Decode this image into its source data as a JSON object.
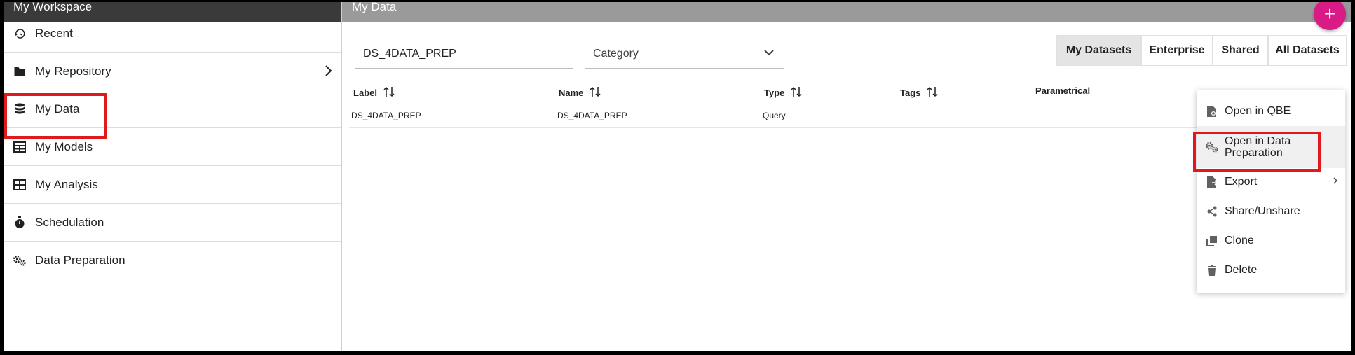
{
  "sidebar": {
    "title": "My Workspace",
    "items": [
      {
        "label": "Recent",
        "icon": "history-icon"
      },
      {
        "label": "My Repository",
        "icon": "folder-icon"
      },
      {
        "label": "My Data",
        "icon": "database-icon"
      },
      {
        "label": "My Models",
        "icon": "table-icon"
      },
      {
        "label": "My Analysis",
        "icon": "grid-icon"
      },
      {
        "label": "Schedulation",
        "icon": "stopwatch-icon"
      },
      {
        "label": "Data Preparation",
        "icon": "gears-icon"
      }
    ]
  },
  "main": {
    "title": "My Data",
    "fab_label": "+",
    "search": {
      "value": "DS_4DATA_PREP"
    },
    "category": {
      "placeholder": "Category"
    },
    "tabs": [
      "My Datasets",
      "Enterprise",
      "Shared",
      "All Datasets"
    ],
    "active_tab": "My Datasets",
    "table": {
      "columns": [
        "Label",
        "Name",
        "Type",
        "Tags",
        "Parametrical"
      ],
      "rows": [
        {
          "label": "DS_4DATA_PREP",
          "name": "DS_4DATA_PREP",
          "type": "Query",
          "tags": "",
          "parametrical": ""
        }
      ]
    }
  },
  "context_menu": {
    "items": [
      {
        "label": "Open in QBE",
        "icon": "file-search-icon"
      },
      {
        "label": "Open in Data Preparation",
        "icon": "gears-icon"
      },
      {
        "label": "Export",
        "icon": "file-export-icon"
      },
      {
        "label": "Share/Unshare",
        "icon": "share-icon"
      },
      {
        "label": "Clone",
        "icon": "clone-icon"
      },
      {
        "label": "Delete",
        "icon": "trash-icon"
      }
    ]
  },
  "colors": {
    "accent": "#d81b86",
    "highlight": "#e0191f",
    "sidebar_header": "#3a3a3a",
    "main_header": "#9a9a9a"
  }
}
